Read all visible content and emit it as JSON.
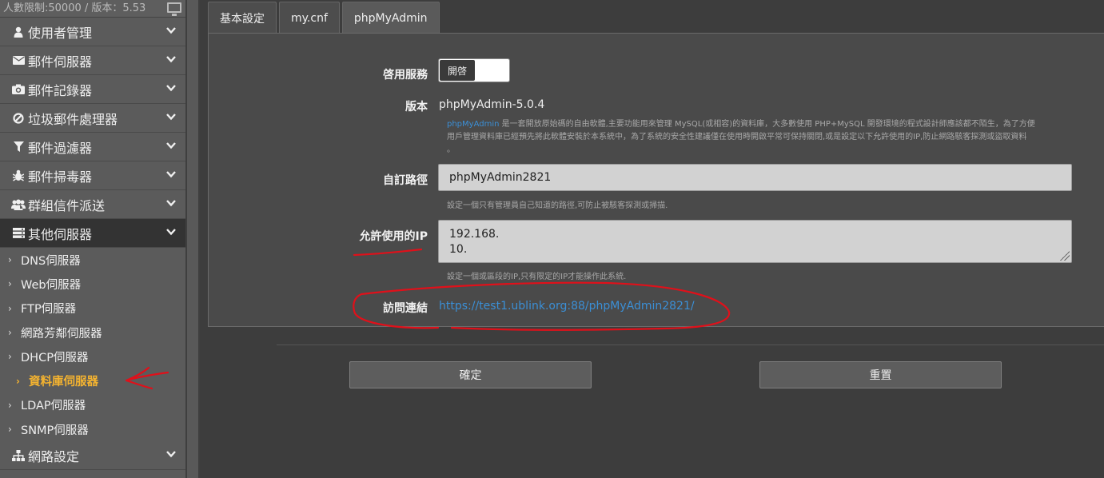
{
  "sidebar": {
    "top_text": "人數限制:50000 / 版本：5.53",
    "top_icon": "monitor-icon",
    "menus": [
      {
        "label": "使用者管理",
        "icon": "user-icon"
      },
      {
        "label": "郵件伺服器",
        "icon": "envelope-icon"
      },
      {
        "label": "郵件記錄器",
        "icon": "camera-icon"
      },
      {
        "label": "垃圾郵件處理器",
        "icon": "ban-icon"
      },
      {
        "label": "郵件過濾器",
        "icon": "filter-icon"
      },
      {
        "label": "郵件掃毒器",
        "icon": "bug-icon"
      },
      {
        "label": "群組信件派送",
        "icon": "users-icon"
      },
      {
        "label": "其他伺服器",
        "icon": "server-icon"
      }
    ],
    "submenus": [
      {
        "label": "DNS伺服器"
      },
      {
        "label": "Web伺服器"
      },
      {
        "label": "FTP伺服器"
      },
      {
        "label": "網路芳鄰伺服器"
      },
      {
        "label": "DHCP伺服器"
      },
      {
        "label": "資料庫伺服器"
      },
      {
        "label": "LDAP伺服器"
      },
      {
        "label": "SNMP伺服器"
      }
    ],
    "bottom_menu": {
      "label": "網路設定",
      "icon": "sitemap-icon"
    }
  },
  "tabs": [
    {
      "label": "基本設定"
    },
    {
      "label": "my.cnf"
    },
    {
      "label": "phpMyAdmin"
    }
  ],
  "form": {
    "service_label": "啓用服務",
    "service_toggle": "開啓",
    "version_label": "版本",
    "version_value": "phpMyAdmin-5.0.4",
    "desc_link": "phpMyAdmin",
    "desc_text_1": " 是一套開放原始碼的自由軟體,主要功能用來管理 MySQL(或相容)的資料庫，大多數使用 PHP+MySQL 開發環境的程式設計師應該都不陌生，為了方便",
    "desc_text_2": "用戶管理資料庫已經預先將此軟體安裝於本系統中，為了系統的安全性建議僅在使用時開啟平常可保持關閉,或是設定以下允許使用的IP,防止網路駭客探測或盜取資料",
    "desc_text_3": "。",
    "path_label": "自訂路徑",
    "path_value": "phpMyAdmin2821",
    "path_hint": "設定一個只有管理員自己知道的路徑,可防止被駭客探測或掃描.",
    "ip_label": "允許使用的IP",
    "ip_value": "192.168.\n10.",
    "ip_hint": "設定一個或區段的IP,只有限定的IP才能操作此系統.",
    "visit_label": "訪問連結",
    "visit_url": "https://test1.ublink.org:88/phpMyAdmin2821/"
  },
  "buttons": {
    "confirm": "確定",
    "reset": "重置"
  },
  "colors": {
    "accent_link": "#3b8fd6",
    "selected_submenu": "#f4b330",
    "annotation": "#e0101a"
  }
}
